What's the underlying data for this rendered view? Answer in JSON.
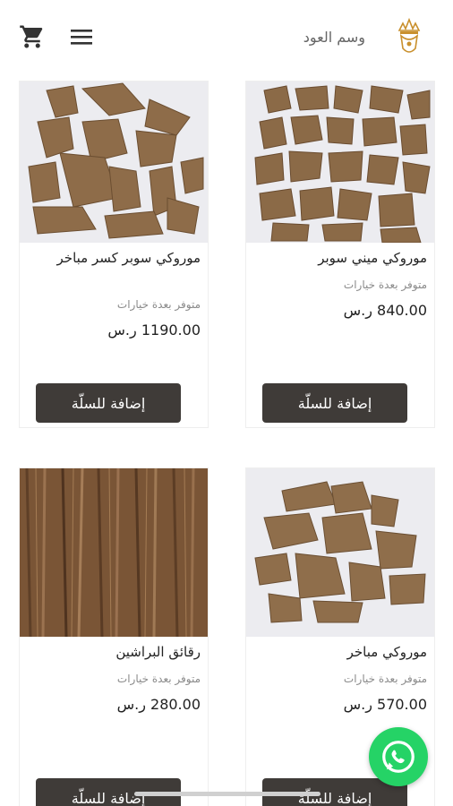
{
  "header": {
    "brand_name": "وسم العود",
    "icons": {
      "cart": "cart-icon",
      "menu": "hamburger-menu-icon",
      "logo": "crown-logo"
    }
  },
  "products": [
    {
      "title": "موروكي سوبر كسر مباخر",
      "availability": "متوفر بعدة خيارات",
      "price": "1190.00 ر.س",
      "button": "إضافة للسلّة"
    },
    {
      "title": "موروكي ميني سوبر",
      "availability": "متوفر بعدة خيارات",
      "price": "840.00 ر.س",
      "button": "إضافة للسلّة"
    },
    {
      "title": "رقائق البراشين",
      "availability": "متوفر بعدة خيارات",
      "price": "280.00 ر.س",
      "button": "إضافة للسلّة"
    },
    {
      "title": "موروكي مباخر",
      "availability": "متوفر بعدة خيارات",
      "price": "570.00 ر.س",
      "button": "إضافة للسلّة"
    }
  ],
  "colors": {
    "button_bg": "#3f3b38",
    "whatsapp_green": "#25d366",
    "image_bg": "#ececf0",
    "wood": "#8a6a48"
  },
  "floating": {
    "whatsapp": "whatsapp-icon"
  }
}
